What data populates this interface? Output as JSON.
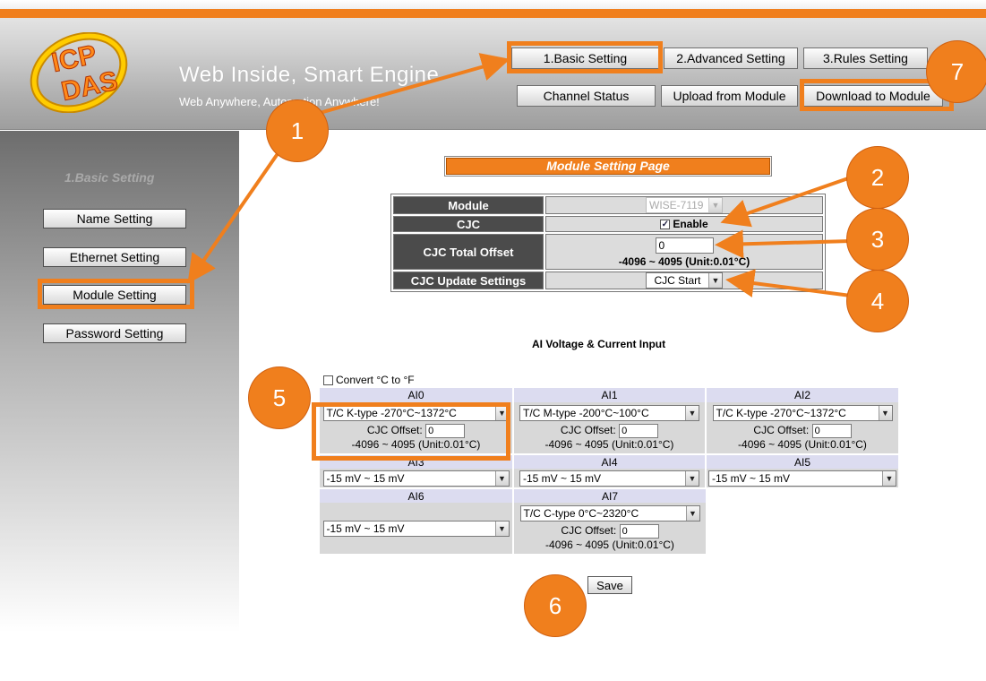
{
  "header": {
    "logo_text": "ICP DAS",
    "slogan_main": "Web Inside, Smart Engine",
    "slogan_sub": "Web Anywhere, Automation Anywhere!",
    "tabs": [
      "1.Basic Setting",
      "2.Advanced Setting",
      "3.Rules Setting"
    ],
    "actions": [
      "Channel Status",
      "Upload from Module",
      "Download to Module"
    ]
  },
  "sidebar": {
    "title": "1.Basic Setting",
    "items": [
      {
        "label": "Name Setting"
      },
      {
        "label": "Ethernet Setting"
      },
      {
        "label": "Module Setting"
      },
      {
        "label": "Password Setting"
      }
    ]
  },
  "page_title": "Module Setting Page",
  "module_table": {
    "module_label": "Module",
    "module_value": "WISE-7119",
    "cjc_label": "CJC",
    "cjc_enable_label": "Enable",
    "cjc_enabled": true,
    "offset_label": "CJC Total Offset",
    "offset_value": "0",
    "offset_range": "-4096 ~ 4095 (Unit:0.01°C)",
    "update_label": "CJC Update Settings",
    "update_value": "CJC Start"
  },
  "ai_section": {
    "title": "AI Voltage & Current Input",
    "convert_label": "Convert °C to °F",
    "cjc_offset_label": "CJC Offset:",
    "range_note": "-4096 ~ 4095 (Unit:0.01°C)",
    "channels": [
      {
        "name": "AI0",
        "type": "T/C K-type -270°C~1372°C",
        "cjc_offset": "0"
      },
      {
        "name": "AI1",
        "type": "T/C M-type -200°C~100°C",
        "cjc_offset": "0"
      },
      {
        "name": "AI2",
        "type": "T/C K-type -270°C~1372°C",
        "cjc_offset": "0"
      },
      {
        "name": "AI3",
        "type": "-15 mV ~ 15 mV"
      },
      {
        "name": "AI4",
        "type": "-15 mV ~ 15 mV"
      },
      {
        "name": "AI5",
        "type": "-15 mV ~ 15 mV"
      },
      {
        "name": "AI6",
        "type": "-15 mV ~ 15 mV"
      },
      {
        "name": "AI7",
        "type": "T/C C-type 0°C~2320°C",
        "cjc_offset": "0"
      }
    ],
    "save_label": "Save"
  },
  "callouts": [
    "1",
    "1",
    "2",
    "3",
    "4",
    "5",
    "6",
    "7"
  ],
  "colors": {
    "accent": "#f07f1d",
    "label_bg": "#4b4b4b",
    "value_bg": "#dcdcdc",
    "channel_header_bg": "#dcdcf0"
  }
}
